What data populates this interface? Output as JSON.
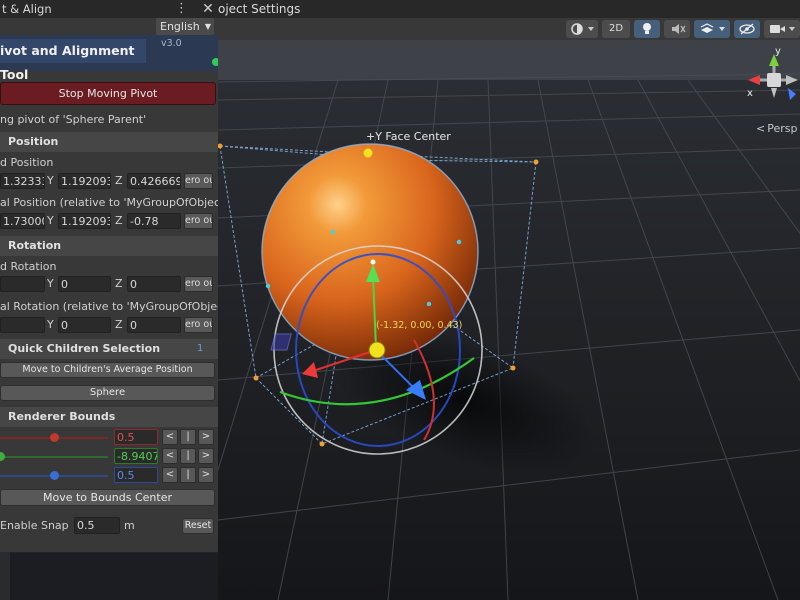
{
  "window": {
    "title": "t & Align",
    "menu_glyph": "⋮",
    "close_glyph": "✕",
    "project_tab": "oject Settings"
  },
  "scene_toolbar": {
    "mode_2d": "2D",
    "icons": [
      "shading-mode-icon",
      "lighting-toggle-icon",
      "audio-toggle-icon",
      "effects-icon",
      "hidden-objects-icon",
      "camera-icon"
    ]
  },
  "panel": {
    "language": "English",
    "tool_title": "ivot and Alignment Tool",
    "version": "v3.0",
    "stop_button": "Stop Moving Pivot",
    "status": "ng pivot of 'Sphere Parent'",
    "position": {
      "header": "Position",
      "world_label": "d Position",
      "world": {
        "x": "1.32333",
        "y": "1.192093",
        "z": "0.426669"
      },
      "local_label": "al Position (relative to 'MyGroupOfObjects",
      "local": {
        "x": "1.73000",
        "y": "1.192093",
        "z": "-0.78"
      },
      "zero_btn": "ero ou"
    },
    "rotation": {
      "header": "Rotation",
      "world_label": "d Rotation",
      "world": {
        "x": "",
        "y": "0",
        "z": "0"
      },
      "local_label": "al Rotation (relative to 'MyGroupOfObjects",
      "local": {
        "x": "",
        "y": "0",
        "z": "0"
      },
      "zero_btn": "ero ou"
    },
    "axis_labels": {
      "y": "Y",
      "z": "Z"
    },
    "children": {
      "header": "Quick Children Selection",
      "count": "1",
      "average_button": "Move to Children's Average Position",
      "child_button": "Sphere"
    },
    "bounds": {
      "header": "Renderer Bounds",
      "x": {
        "value": "0.5",
        "color": "#c0392b",
        "fraction": 0.5
      },
      "y": {
        "value": "-8.9407",
        "color": "#3fae3f",
        "fraction": 0.0
      },
      "z": {
        "value": "0.5",
        "color": "#3a6fd1",
        "fraction": 0.5
      },
      "arrows": [
        "<",
        "|",
        ">"
      ],
      "center_button": "Move to Bounds Center"
    },
    "snap": {
      "label": "Enable Snap",
      "value": "0.5",
      "unit": "m",
      "reset": "Reset"
    }
  },
  "viewport": {
    "face_label": "+Y Face Center",
    "coord_label": "(-1.32, 0.00, 0.43)",
    "projection": "Persp",
    "gizmo_axes": {
      "x": "x",
      "y": "y"
    },
    "colors": {
      "sphere": "#e07a1f",
      "bounds": "#7fb0e0",
      "handle": "#f0a030",
      "x_axis": "#e03030",
      "y_axis": "#40d040",
      "z_axis": "#3070f0"
    }
  }
}
